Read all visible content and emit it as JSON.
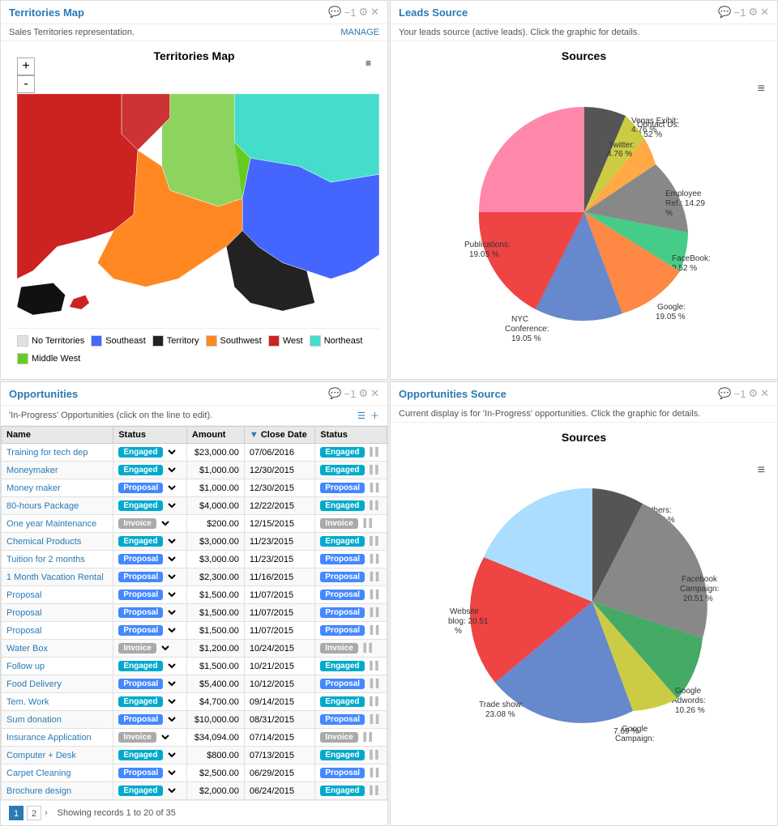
{
  "territories_map": {
    "title": "Territories Map",
    "subtitle": "Sales Territories representation.",
    "manage_label": "MANAGE",
    "map_title": "Territories Map",
    "zoom_in": "+",
    "zoom_out": "-",
    "legend": [
      {
        "label": "No Territories",
        "color": "#e0e0e0"
      },
      {
        "label": "Southeast",
        "color": "#4466ff"
      },
      {
        "label": "Territory",
        "color": "#222222"
      },
      {
        "label": "Southwest",
        "color": "#ff8822"
      },
      {
        "label": "West",
        "color": "#cc2222"
      },
      {
        "label": "Northeast",
        "color": "#44ddcc"
      },
      {
        "label": "Middle West",
        "color": "#66cc22"
      }
    ]
  },
  "leads_source": {
    "title": "Leads Source",
    "subtitle": "Your leads source (active leads). Click the graphic for details.",
    "chart_title": "Sources",
    "segments": [
      {
        "label": "Contact Us:",
        "value": "9.52 %",
        "color": "#555555",
        "percent": 9.52
      },
      {
        "label": "Vegas Exibit:",
        "value": "4.76 %",
        "color": "#cccc44",
        "percent": 4.76
      },
      {
        "label": "Twitter:",
        "value": "4.76 %",
        "color": "#ffaa44",
        "percent": 4.76
      },
      {
        "label": "Publications:",
        "value": "19.05 %",
        "color": "#ee4444",
        "percent": 19.05
      },
      {
        "label": "NYC Conference:",
        "value": "19.05 %",
        "color": "#6688cc",
        "percent": 19.05
      },
      {
        "label": "Google:",
        "value": "19.05 %",
        "color": "#ff8844",
        "percent": 19.05
      },
      {
        "label": "FaceBook:",
        "value": "9.52 %",
        "color": "#44cc88",
        "percent": 9.52
      },
      {
        "label": "Employee Ref.:",
        "value": "14.29 %",
        "color": "#888888",
        "percent": 14.29
      }
    ]
  },
  "opportunities": {
    "title": "Opportunities",
    "subtitle": "'In-Progress' Opportunities (click on the line to edit).",
    "columns": [
      "Name",
      "Status",
      "Amount",
      "▼ Close Date",
      "Status"
    ],
    "rows": [
      {
        "name": "Training for tech dep",
        "status": "Engaged",
        "amount": "$23,000.00",
        "close_date": "07/06/2016",
        "badge": "Engaged",
        "badge_type": "engaged"
      },
      {
        "name": "Moneymaker",
        "status": "Engaged",
        "amount": "$1,000.00",
        "close_date": "12/30/2015",
        "badge": "Engaged",
        "badge_type": "engaged"
      },
      {
        "name": "Money maker",
        "status": "Proposal",
        "amount": "$1,000.00",
        "close_date": "12/30/2015",
        "badge": "Proposal",
        "badge_type": "proposal"
      },
      {
        "name": "80-hours Package",
        "status": "Engaged",
        "amount": "$4,000.00",
        "close_date": "12/22/2015",
        "badge": "Engaged",
        "badge_type": "engaged"
      },
      {
        "name": "One year Maintenance",
        "status": "Invoice",
        "amount": "$200.00",
        "close_date": "12/15/2015",
        "badge": "Invoice",
        "badge_type": "invoice"
      },
      {
        "name": "Chemical Products",
        "status": "Engaged",
        "amount": "$3,000.00",
        "close_date": "11/23/2015",
        "badge": "Engaged",
        "badge_type": "engaged"
      },
      {
        "name": "Tuition for 2 months",
        "status": "Proposal",
        "amount": "$3,000.00",
        "close_date": "11/23/2015",
        "badge": "Proposal",
        "badge_type": "proposal"
      },
      {
        "name": "1 Month Vacation Rental",
        "status": "Proposal",
        "amount": "$2,300.00",
        "close_date": "11/16/2015",
        "badge": "Proposal",
        "badge_type": "proposal"
      },
      {
        "name": "Proposal",
        "status": "Proposal",
        "amount": "$1,500.00",
        "close_date": "11/07/2015",
        "badge": "Proposal",
        "badge_type": "proposal"
      },
      {
        "name": "Proposal",
        "status": "Proposal",
        "amount": "$1,500.00",
        "close_date": "11/07/2015",
        "badge": "Proposal",
        "badge_type": "proposal"
      },
      {
        "name": "Proposal",
        "status": "Proposal",
        "amount": "$1,500.00",
        "close_date": "11/07/2015",
        "badge": "Proposal",
        "badge_type": "proposal"
      },
      {
        "name": "Water Box",
        "status": "Invoice",
        "amount": "$1,200.00",
        "close_date": "10/24/2015",
        "badge": "Invoice",
        "badge_type": "invoice"
      },
      {
        "name": "Follow up",
        "status": "Engaged",
        "amount": "$1,500.00",
        "close_date": "10/21/2015",
        "badge": "Engaged",
        "badge_type": "engaged"
      },
      {
        "name": "Food Delivery",
        "status": "Proposal",
        "amount": "$5,400.00",
        "close_date": "10/12/2015",
        "badge": "Proposal",
        "badge_type": "proposal"
      },
      {
        "name": "Tem. Work",
        "status": "Engaged",
        "amount": "$4,700.00",
        "close_date": "09/14/2015",
        "badge": "Engaged",
        "badge_type": "engaged"
      },
      {
        "name": "Sum donation",
        "status": "Proposal",
        "amount": "$10,000.00",
        "close_date": "08/31/2015",
        "badge": "Proposal",
        "badge_type": "proposal"
      },
      {
        "name": "Insurance Application",
        "status": "Invoice",
        "amount": "$34,094.00",
        "close_date": "07/14/2015",
        "badge": "Invoice",
        "badge_type": "invoice"
      },
      {
        "name": "Computer + Desk",
        "status": "Engaged",
        "amount": "$800.00",
        "close_date": "07/13/2015",
        "badge": "Engaged",
        "badge_type": "engaged"
      },
      {
        "name": "Carpet Cleaning",
        "status": "Proposal",
        "amount": "$2,500.00",
        "close_date": "06/29/2015",
        "badge": "Proposal",
        "badge_type": "proposal"
      },
      {
        "name": "Brochure design",
        "status": "Engaged",
        "amount": "$2,000.00",
        "close_date": "06/24/2015",
        "badge": "Engaged",
        "badge_type": "engaged"
      }
    ],
    "pagination": "Showing records 1 to 20 of 35",
    "pages": [
      "1",
      "2"
    ]
  },
  "opportunities_source": {
    "title": "Opportunities Source",
    "subtitle": "Current display is for 'In-Progress' opportunities. Click the graphic for details.",
    "chart_title": "Sources",
    "segments": [
      {
        "label": "Others:",
        "value": "17.95 %",
        "color": "#555555",
        "percent": 17.95
      },
      {
        "label": "Facebook Campaign:",
        "value": "20.51 %",
        "color": "#888888",
        "percent": 20.51
      },
      {
        "label": "Google Adwords:",
        "value": "10.26 %",
        "color": "#44aa66",
        "percent": 10.26
      },
      {
        "label": "Google Campaign:",
        "value": "7.69 %",
        "color": "#cccc44",
        "percent": 7.69
      },
      {
        "label": "Trade show:",
        "value": "23.08 %",
        "color": "#6688cc",
        "percent": 23.08
      },
      {
        "label": "Website blog:",
        "value": "20.51 %",
        "color": "#ee4444",
        "percent": 20.51
      }
    ]
  }
}
